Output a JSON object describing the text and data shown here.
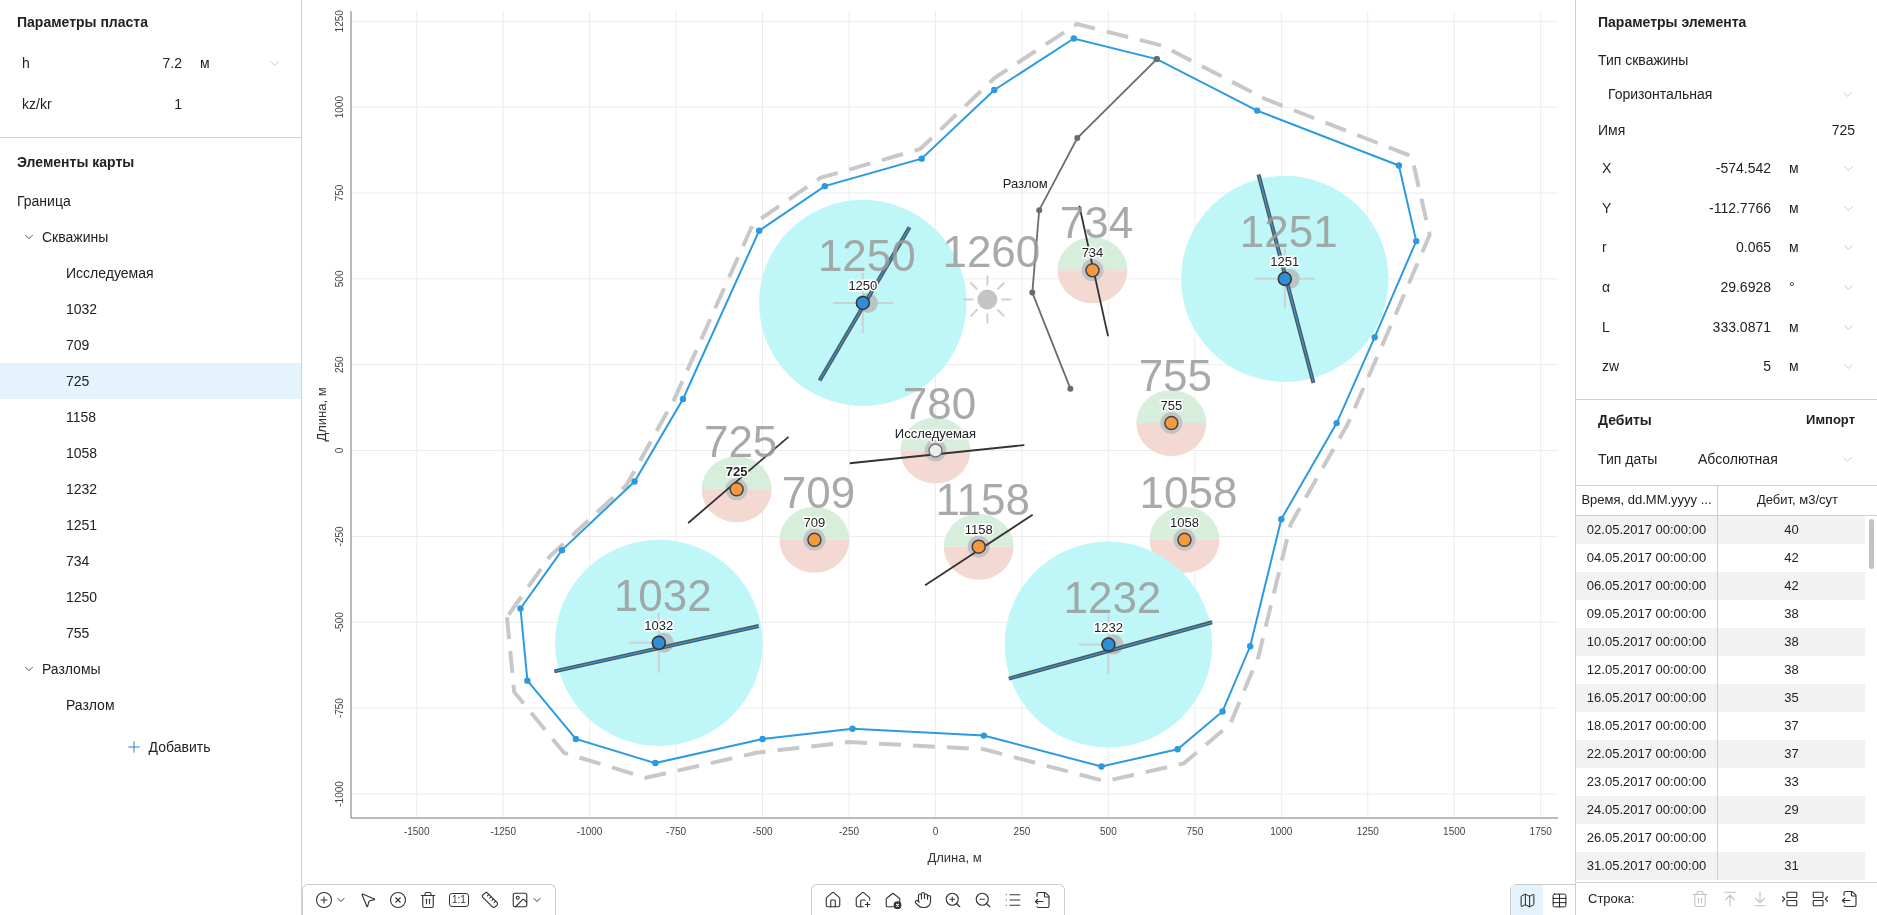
{
  "layer_params": {
    "title": "Параметры пласта",
    "rows": [
      {
        "name": "h",
        "value": "7.2",
        "unit": "м",
        "kind": "select"
      },
      {
        "name": "kz/kr",
        "value": "1",
        "kind": "plain"
      }
    ]
  },
  "map_elements": {
    "title": "Элементы карты",
    "items": [
      {
        "label": "Граница",
        "selected": false
      },
      {
        "label": "Скважины",
        "selected": false,
        "expanded": true,
        "children": [
          {
            "label": "Исследуемая",
            "selected": false
          },
          {
            "label": "1032",
            "selected": false
          },
          {
            "label": "709",
            "selected": false
          },
          {
            "label": "725",
            "selected": true
          },
          {
            "label": "1158",
            "selected": false
          },
          {
            "label": "1058",
            "selected": false
          },
          {
            "label": "1232",
            "selected": false
          },
          {
            "label": "1251",
            "selected": false
          },
          {
            "label": "734",
            "selected": false
          },
          {
            "label": "1250",
            "selected": false
          },
          {
            "label": "755",
            "selected": false
          }
        ]
      },
      {
        "label": "Разломы",
        "selected": false,
        "expanded": true,
        "children": [
          {
            "label": "Разлом",
            "selected": false
          }
        ]
      }
    ],
    "add_button": "Добавить"
  },
  "map": {
    "x_title": "Длина, м",
    "y_title": "Длина, м",
    "x_ticks": [
      "-1500",
      "-1250",
      "-1000",
      "-750",
      "-500",
      "-250",
      "0",
      "250",
      "500",
      "750",
      "1000",
      "1250",
      "1500",
      "1750"
    ],
    "y_ticks": [
      "-1000",
      "-750",
      "-500",
      "-250",
      "0",
      "250",
      "500",
      "750",
      "1000",
      "1250"
    ],
    "fault_label": "Разлом",
    "wells": [
      {
        "kind": "horizontal",
        "label": "1250",
        "tag": "1250",
        "selected": false
      },
      {
        "kind": "inactive",
        "tag": "1260"
      },
      {
        "kind": "injection",
        "label": "734",
        "tag": "734",
        "selected": false
      },
      {
        "kind": "horizontal",
        "label": "1251",
        "tag": "1251",
        "selected": false
      },
      {
        "kind": "injection",
        "label": "755",
        "tag": "755",
        "selected": false
      },
      {
        "kind": "study",
        "label": "Исследуемая",
        "tag": "780",
        "selected": false
      },
      {
        "kind": "injection",
        "label": "725",
        "tag": "725",
        "selected": true
      },
      {
        "kind": "injection",
        "label": "709",
        "tag": "709",
        "selected": false
      },
      {
        "kind": "injection",
        "label": "1158",
        "tag": "1158",
        "selected": false
      },
      {
        "kind": "injection",
        "label": "1058",
        "tag": "1058",
        "selected": false
      },
      {
        "kind": "horizontal",
        "label": "1032",
        "tag": "1032",
        "selected": false
      },
      {
        "kind": "horizontal",
        "label": "1232",
        "tag": "1232",
        "selected": false
      }
    ]
  },
  "left_toolbar": [
    {
      "kind": "lasso-add",
      "dropdown": true
    },
    {
      "kind": "pointer"
    },
    {
      "kind": "clear"
    },
    {
      "kind": "delete"
    },
    {
      "kind": "scale",
      "text": "1:1"
    },
    {
      "kind": "ruler"
    },
    {
      "kind": "image",
      "dropdown": true
    }
  ],
  "center_toolbar": [
    {
      "kind": "home"
    },
    {
      "kind": "home-add"
    },
    {
      "kind": "home-remove"
    },
    {
      "kind": "pan"
    },
    {
      "kind": "zoom-in"
    },
    {
      "kind": "zoom-out"
    },
    {
      "kind": "list"
    },
    {
      "kind": "export"
    }
  ],
  "view_toggle": [
    {
      "kind": "map",
      "selected": true
    },
    {
      "kind": "table",
      "selected": false
    }
  ],
  "element_params": {
    "title": "Параметры элемента",
    "well_type": {
      "label": "Тип скважины",
      "value": "Горизонтальная"
    },
    "name": {
      "label": "Имя",
      "value": "725"
    },
    "rows": [
      {
        "name": "X",
        "value": "-574.542",
        "unit": "м"
      },
      {
        "name": "Y",
        "value": "-112.7766",
        "unit": "м"
      },
      {
        "name": "r",
        "value": "0.065",
        "unit": "м"
      },
      {
        "name": "α",
        "value": "29.6928",
        "unit": "°"
      },
      {
        "name": "L",
        "value": "333.0871",
        "unit": "м"
      },
      {
        "name": "zw",
        "value": "5",
        "unit": "м"
      }
    ]
  },
  "rates": {
    "title": "Дебиты",
    "import_button": "Импорт",
    "date_type": {
      "label": "Тип даты",
      "value": "Абсолютная"
    },
    "table": {
      "columns": [
        "Время, dd.MM.yyyy ...",
        "Дебит, м3/сут"
      ],
      "rows": [
        [
          "02.05.2017 00:00:00",
          "40"
        ],
        [
          "04.05.2017 00:00:00",
          "42"
        ],
        [
          "06.05.2017 00:00:00",
          "42"
        ],
        [
          "09.05.2017 00:00:00",
          "38"
        ],
        [
          "10.05.2017 00:00:00",
          "38"
        ],
        [
          "12.05.2017 00:00:00",
          "38"
        ],
        [
          "16.05.2017 00:00:00",
          "35"
        ],
        [
          "18.05.2017 00:00:00",
          "37"
        ],
        [
          "22.05.2017 00:00:00",
          "37"
        ],
        [
          "23.05.2017 00:00:00",
          "33"
        ],
        [
          "24.05.2017 00:00:00",
          "29"
        ],
        [
          "26.05.2017 00:00:00",
          "28"
        ],
        [
          "31.05.2017 00:00:00",
          "31"
        ]
      ]
    },
    "row_bar": {
      "label": "Строка:",
      "buttons": [
        {
          "kind": "delete",
          "disabled": true
        },
        {
          "kind": "insert-above",
          "disabled": true
        },
        {
          "kind": "insert-below",
          "disabled": true
        },
        {
          "kind": "add-row-above",
          "disabled": false
        },
        {
          "kind": "add-row-below",
          "disabled": false
        },
        {
          "kind": "export",
          "disabled": false
        }
      ]
    }
  }
}
